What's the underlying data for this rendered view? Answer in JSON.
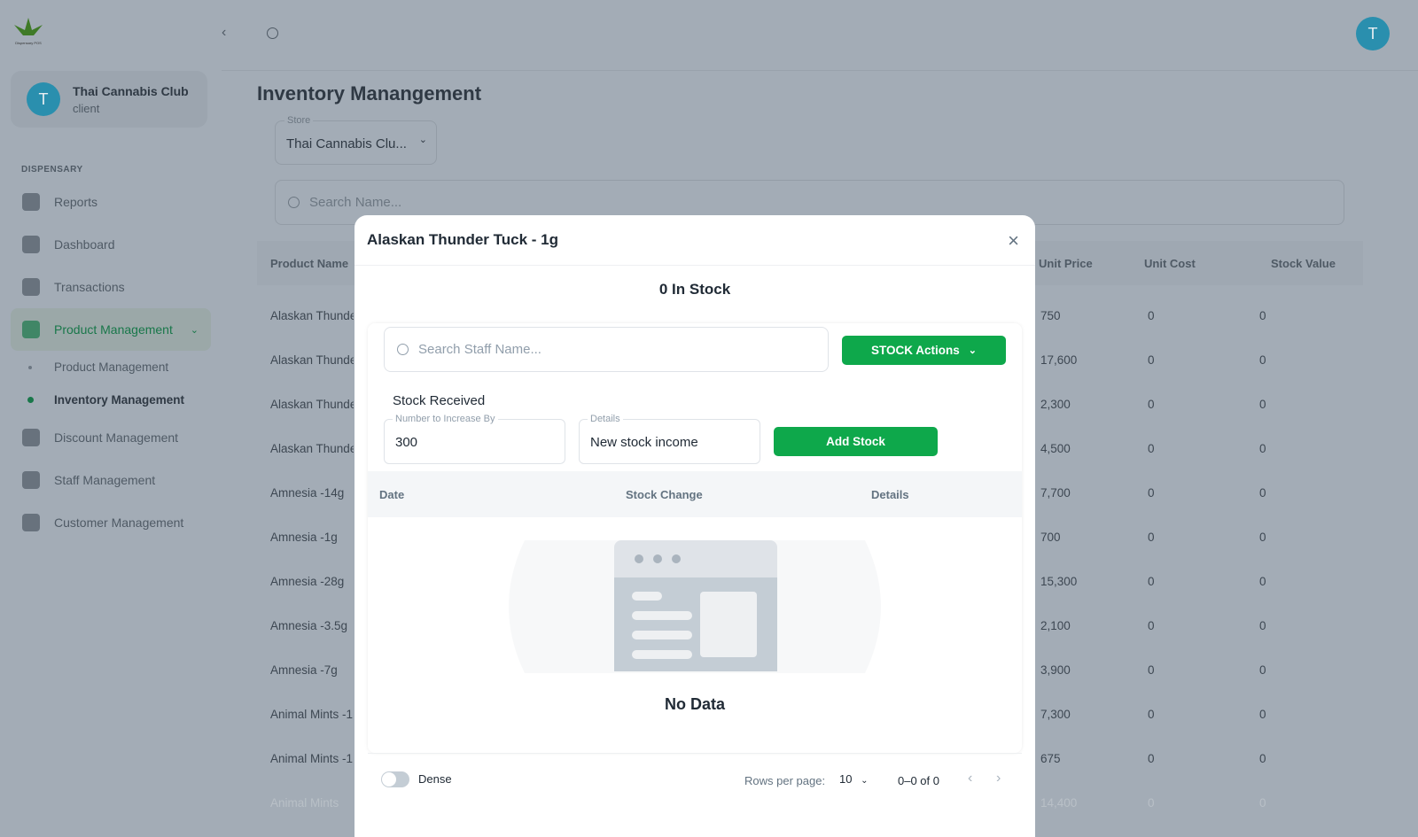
{
  "sidebar": {
    "logo_text": "Dispensary POS",
    "account": {
      "initial": "T",
      "name": "Thai Cannabis Club",
      "role": "client"
    },
    "section": "DISPENSARY",
    "items": [
      {
        "label": "Reports",
        "icon": "chart-icon"
      },
      {
        "label": "Dashboard",
        "icon": "gauge-icon"
      },
      {
        "label": "Transactions",
        "icon": "dollar-icon"
      },
      {
        "label": "Product Management",
        "icon": "bag-icon"
      }
    ],
    "subitems": [
      {
        "label": "Product Management"
      },
      {
        "label": "Inventory Management"
      }
    ],
    "items2": [
      {
        "label": "Discount Management",
        "icon": "tag-icon"
      },
      {
        "label": "Staff Management",
        "icon": "badge-icon"
      },
      {
        "label": "Customer Management",
        "icon": "building-icon"
      }
    ]
  },
  "header": {
    "avatar": "T"
  },
  "main": {
    "title": "Inventory Manangement",
    "store_label": "Store",
    "store_value": "Thai Cannabis Clu...",
    "search_placeholder": "Search Name...",
    "columns": [
      "Product Name",
      "Unit Price",
      "Unit Cost",
      "Stock Value"
    ],
    "rows": [
      [
        "Alaskan Thunde",
        "750",
        "0",
        "0"
      ],
      [
        "Alaskan Thunde",
        "17,600",
        "0",
        "0"
      ],
      [
        "Alaskan Thunde",
        "2,300",
        "0",
        "0"
      ],
      [
        "Alaskan Thunde",
        "4,500",
        "0",
        "0"
      ],
      [
        "Amnesia -14g",
        "7,700",
        "0",
        "0"
      ],
      [
        "Amnesia -1g",
        "700",
        "0",
        "0"
      ],
      [
        "Amnesia -28g",
        "15,300",
        "0",
        "0"
      ],
      [
        "Amnesia -3.5g",
        "2,100",
        "0",
        "0"
      ],
      [
        "Amnesia -7g",
        "3,900",
        "0",
        "0"
      ],
      [
        "Animal Mints -1",
        "7,300",
        "0",
        "0"
      ],
      [
        "Animal Mints -1",
        "675",
        "0",
        "0"
      ],
      [
        "Animal Mints",
        "14,400",
        "0",
        "0"
      ]
    ]
  },
  "modal": {
    "title": "Alaskan Thunder Tuck - 1g",
    "stock": "0 In Stock",
    "staff_search_placeholder": "Search Staff Name...",
    "actions_label": "STOCK Actions",
    "section": "Stock Received",
    "increase_label": "Number to Increase By",
    "increase_value": "300",
    "details_label": "Details",
    "details_value": "New stock income",
    "add_label": "Add Stock",
    "columns": [
      "Date",
      "Stock Change",
      "Details"
    ],
    "empty": "No Data",
    "dense_label": "Dense",
    "rows_per_page_label": "Rows per page:",
    "rows_per_page": "10",
    "range": "0–0 of 0"
  },
  "colors": {
    "accent": "#0ea84b",
    "avatar": "#2ba3c8"
  }
}
